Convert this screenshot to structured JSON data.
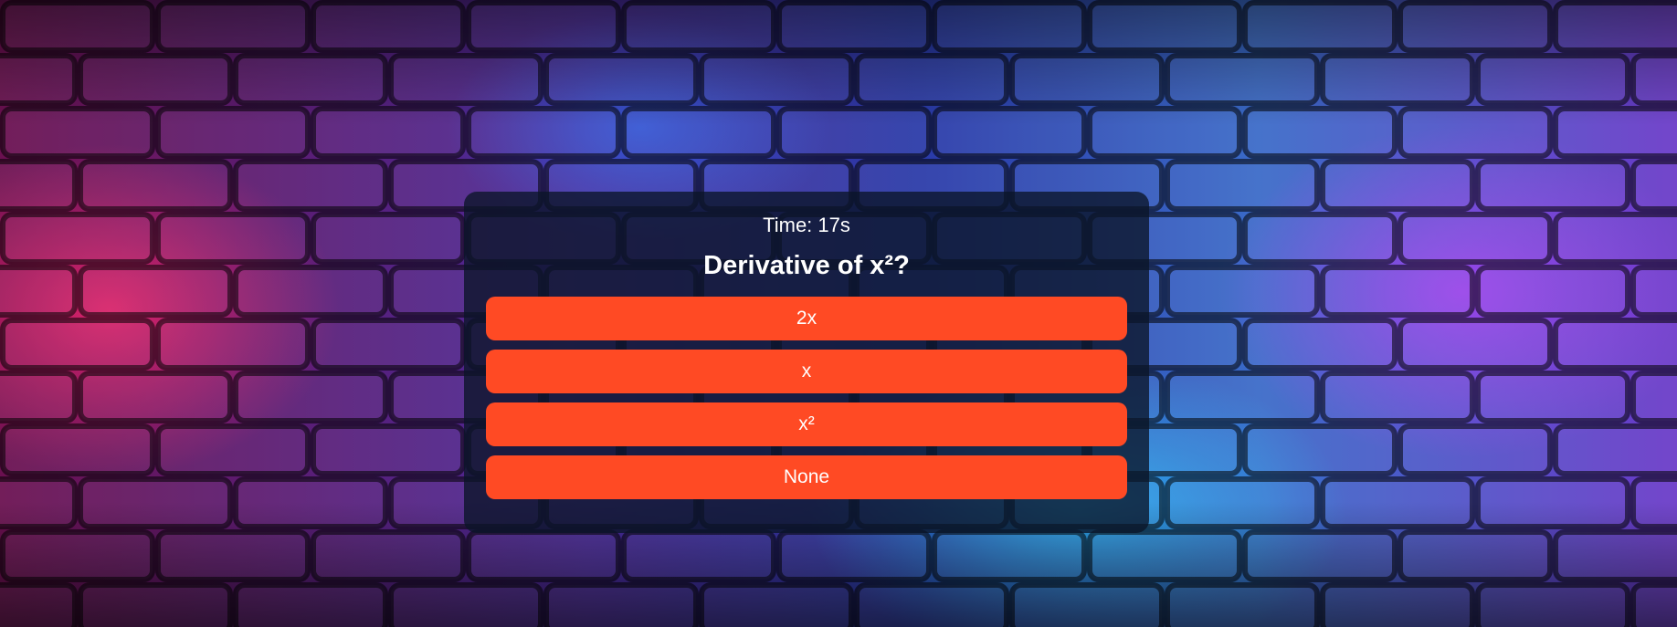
{
  "quiz": {
    "timer_text": "Time: 17s",
    "question": "Derivative of x²?",
    "options": [
      {
        "label": "2x"
      },
      {
        "label": "x"
      },
      {
        "label": "x²"
      },
      {
        "label": "None"
      }
    ]
  },
  "colors": {
    "option_background": "#ff4a24",
    "card_background": "rgba(10, 20, 40, 0.78)",
    "text": "#ffffff"
  }
}
